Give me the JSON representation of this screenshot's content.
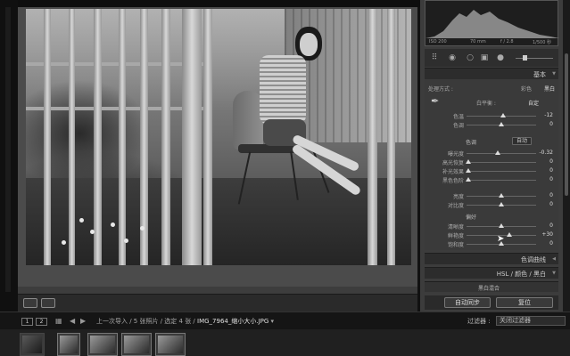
{
  "histogram": {
    "iso": "ISO 200",
    "focal": "70 mm",
    "aperture": "f / 2.8",
    "shutter": "1/500 秒"
  },
  "panels": {
    "basic_title": "基本",
    "tone_curve_title": "色调曲线",
    "hsl_tabs": [
      "HSL",
      "/",
      "颜色",
      "/",
      "黑白"
    ],
    "bw_mix": "黑白混合"
  },
  "basic": {
    "treatment_label": "处理方式 :",
    "treatment_options": [
      "彩色",
      "黑白"
    ],
    "wb_label": "白平衡 :",
    "wb_value": "自定",
    "tone_label": "色调",
    "auto_label": "自动",
    "presence_label": "偏好",
    "sliders": [
      {
        "name": "temp",
        "label": "色温",
        "value": "-12",
        "pos": 0.53
      },
      {
        "name": "tint",
        "label": "色调",
        "value": "0",
        "pos": 0.5
      },
      {
        "name": "exposure",
        "label": "曝光度",
        "value": "-0.32",
        "pos": 0.45
      },
      {
        "name": "highlights",
        "label": "高光恢复",
        "value": "0",
        "pos": 0.02
      },
      {
        "name": "fill",
        "label": "补光效果",
        "value": "0",
        "pos": 0.02
      },
      {
        "name": "blacks",
        "label": "黑色色阶",
        "value": "0",
        "pos": 0.02
      },
      {
        "name": "brightness",
        "label": "亮度",
        "value": "0",
        "pos": 0.5
      },
      {
        "name": "contrast",
        "label": "对比度",
        "value": "0",
        "pos": 0.5
      },
      {
        "name": "clarity",
        "label": "清晰度",
        "value": "0",
        "pos": 0.5
      },
      {
        "name": "vibrance",
        "label": "鲜艳度",
        "value": "+30",
        "pos": 0.62
      },
      {
        "name": "saturation",
        "label": "饱和度",
        "value": "0",
        "pos": 0.5
      }
    ]
  },
  "buttons": {
    "sync": "自动同步",
    "reset": "复位"
  },
  "filmstrip": {
    "page1": "1",
    "page2": "2",
    "info_prefix": "上一次导入 / 5 张照片 / 选定 4 张 /",
    "filename": "IMG_7964_缩小大小.JPG",
    "filter_label": "过滤器 :",
    "filter_value": "关闭过滤器"
  }
}
